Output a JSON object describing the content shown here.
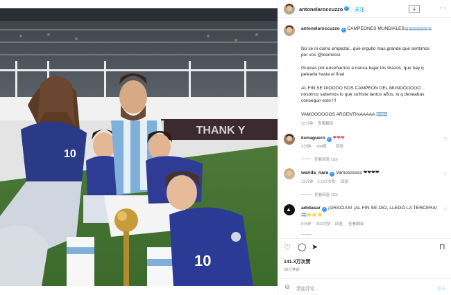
{
  "colors": {
    "accent": "#0095f6",
    "verified": "#3897f0",
    "heart": "#ed4956",
    "muted": "#8e8e8e",
    "text": "#262626"
  },
  "header": {
    "username": "antonelaroccuzzo",
    "follow_label": "关注",
    "download_icon": "download-icon",
    "more_icon": "more-icon"
  },
  "caption": {
    "username": "antonelaroccuzzo",
    "first_line": "CAMPEONES MUNDIALES",
    "first_line_suffix": "🇦🇷🇦🇷🇦🇷🇦🇷🇦🇷🇦🇷🇦🇷",
    "lines": [
      "No se ni como empezar.. que orgullo mas grande que sentimos",
      "por vos @leomessi",
      "",
      "Gracias por enseñarnos a nunca bajar los brazos, que hay q",
      "pelearla hasta el final",
      "",
      "AL FIN SE DIOOOO SOS CAMPEON DEL MUNDOOOOO ..",
      "nosotros sabemos lo que sufriste tantos años, lo q deseabas",
      "conseguir esto !!!",
      "",
      "VAMOOOOOOS ARGENTINAAAAA 🇦🇷🇦🇷"
    ],
    "time": "15分钟",
    "translate": "查看翻译"
  },
  "comments": [
    {
      "user": "kunaguero",
      "verified": true,
      "text": "❤❤❤",
      "time": "3分钟",
      "likes": "984赞",
      "reply": "回复",
      "translate": "",
      "view_replies": "查看回复 (18)"
    },
    {
      "user": "wanda_nara",
      "verified": true,
      "text": "Vamossssss ❤❤❤❤",
      "time": "13分钟",
      "likes": "1,017次赞",
      "reply": "回复",
      "translate": "",
      "view_replies": "查看回复 (19)"
    },
    {
      "user": "adidasar",
      "verified": true,
      "text": "¡GRACIAS! ¡AL FIN SE DIO, LLEGÓ LA TERCERA!",
      "text2": "🇦🇷⭐⭐⭐",
      "time": "9分钟",
      "likes": "802次赞",
      "reply": "回复",
      "translate": "查看翻译",
      "view_replies": ""
    }
  ],
  "actions": {
    "likes": "141.3万次赞",
    "time_ago": "30分钟前",
    "comment_placeholder": "添加评论...",
    "post_label": "发布"
  },
  "photo": {
    "banner_text": "THANK Y",
    "jersey_number_1": "10",
    "jersey_number_2": "10"
  }
}
